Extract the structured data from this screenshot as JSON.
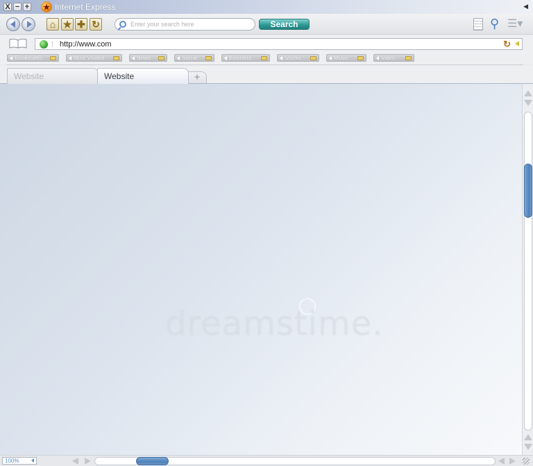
{
  "window": {
    "title": "Internet Express",
    "controls": [
      "X",
      "−",
      "+"
    ],
    "collapse_arrow": "◀"
  },
  "toolbar": {
    "icons": [
      "back-arrow-icon",
      "forward-arrow-icon",
      "home-icon",
      "star-icon",
      "plus-icon",
      "refresh-icon",
      "page-icon",
      "wrench-icon",
      "menu-icon"
    ],
    "home_glyph": "⌂",
    "star_glyph": "★",
    "add_glyph": "✚",
    "refresh_glyph": "↻",
    "wrench_glyph": "⚲",
    "menu_glyph": "☰▾"
  },
  "search": {
    "placeholder": "Enter your search here",
    "button_label": "Search"
  },
  "address": {
    "url": "http://www.com",
    "refresh_glyph": "↻"
  },
  "bookmarks": {
    "items": [
      {
        "label": "Bookmarks"
      },
      {
        "label": "Most Visited"
      },
      {
        "label": "News"
      },
      {
        "label": "Social"
      },
      {
        "label": "Business"
      },
      {
        "label": "Stocks"
      },
      {
        "label": "Music"
      },
      {
        "label": "Video"
      }
    ]
  },
  "tabs": {
    "items": [
      {
        "label": "Website",
        "active": false
      },
      {
        "label": "Website",
        "active": true
      }
    ],
    "new_tab_glyph": "+"
  },
  "content": {
    "watermark": "dreamstime."
  },
  "status": {
    "zoom": "100%"
  },
  "colors": {
    "accent_blue": "#4f82bb",
    "search_teal": "#2e9a96",
    "content_bg": "#dde4ee"
  }
}
